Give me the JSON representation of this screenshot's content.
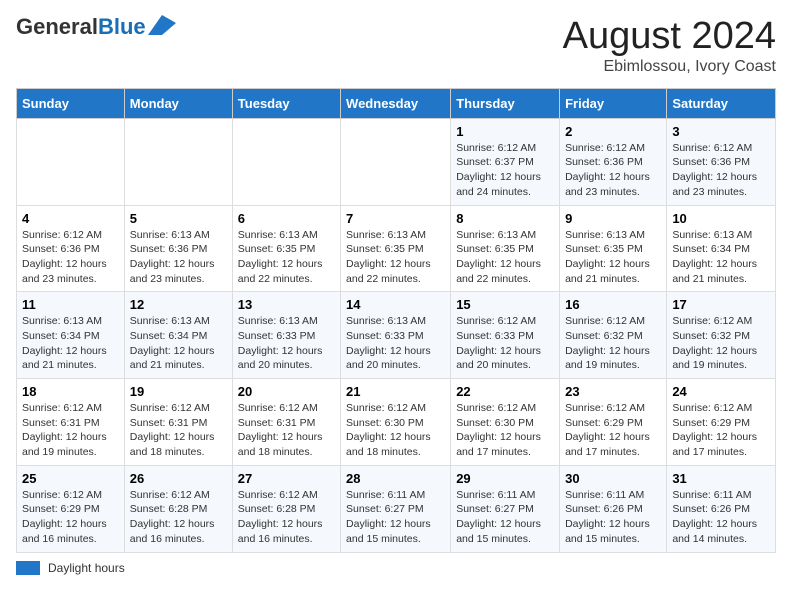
{
  "header": {
    "logo_general": "General",
    "logo_blue": "Blue",
    "title": "August 2024",
    "subtitle": "Ebimlossou, Ivory Coast"
  },
  "weekdays": [
    "Sunday",
    "Monday",
    "Tuesday",
    "Wednesday",
    "Thursday",
    "Friday",
    "Saturday"
  ],
  "weeks": [
    [
      {
        "day": "",
        "detail": ""
      },
      {
        "day": "",
        "detail": ""
      },
      {
        "day": "",
        "detail": ""
      },
      {
        "day": "",
        "detail": ""
      },
      {
        "day": "1",
        "detail": "Sunrise: 6:12 AM\nSunset: 6:37 PM\nDaylight: 12 hours and 24 minutes."
      },
      {
        "day": "2",
        "detail": "Sunrise: 6:12 AM\nSunset: 6:36 PM\nDaylight: 12 hours and 23 minutes."
      },
      {
        "day": "3",
        "detail": "Sunrise: 6:12 AM\nSunset: 6:36 PM\nDaylight: 12 hours and 23 minutes."
      }
    ],
    [
      {
        "day": "4",
        "detail": "Sunrise: 6:12 AM\nSunset: 6:36 PM\nDaylight: 12 hours and 23 minutes."
      },
      {
        "day": "5",
        "detail": "Sunrise: 6:13 AM\nSunset: 6:36 PM\nDaylight: 12 hours and 23 minutes."
      },
      {
        "day": "6",
        "detail": "Sunrise: 6:13 AM\nSunset: 6:35 PM\nDaylight: 12 hours and 22 minutes."
      },
      {
        "day": "7",
        "detail": "Sunrise: 6:13 AM\nSunset: 6:35 PM\nDaylight: 12 hours and 22 minutes."
      },
      {
        "day": "8",
        "detail": "Sunrise: 6:13 AM\nSunset: 6:35 PM\nDaylight: 12 hours and 22 minutes."
      },
      {
        "day": "9",
        "detail": "Sunrise: 6:13 AM\nSunset: 6:35 PM\nDaylight: 12 hours and 21 minutes."
      },
      {
        "day": "10",
        "detail": "Sunrise: 6:13 AM\nSunset: 6:34 PM\nDaylight: 12 hours and 21 minutes."
      }
    ],
    [
      {
        "day": "11",
        "detail": "Sunrise: 6:13 AM\nSunset: 6:34 PM\nDaylight: 12 hours and 21 minutes."
      },
      {
        "day": "12",
        "detail": "Sunrise: 6:13 AM\nSunset: 6:34 PM\nDaylight: 12 hours and 21 minutes."
      },
      {
        "day": "13",
        "detail": "Sunrise: 6:13 AM\nSunset: 6:33 PM\nDaylight: 12 hours and 20 minutes."
      },
      {
        "day": "14",
        "detail": "Sunrise: 6:13 AM\nSunset: 6:33 PM\nDaylight: 12 hours and 20 minutes."
      },
      {
        "day": "15",
        "detail": "Sunrise: 6:12 AM\nSunset: 6:33 PM\nDaylight: 12 hours and 20 minutes."
      },
      {
        "day": "16",
        "detail": "Sunrise: 6:12 AM\nSunset: 6:32 PM\nDaylight: 12 hours and 19 minutes."
      },
      {
        "day": "17",
        "detail": "Sunrise: 6:12 AM\nSunset: 6:32 PM\nDaylight: 12 hours and 19 minutes."
      }
    ],
    [
      {
        "day": "18",
        "detail": "Sunrise: 6:12 AM\nSunset: 6:31 PM\nDaylight: 12 hours and 19 minutes."
      },
      {
        "day": "19",
        "detail": "Sunrise: 6:12 AM\nSunset: 6:31 PM\nDaylight: 12 hours and 18 minutes."
      },
      {
        "day": "20",
        "detail": "Sunrise: 6:12 AM\nSunset: 6:31 PM\nDaylight: 12 hours and 18 minutes."
      },
      {
        "day": "21",
        "detail": "Sunrise: 6:12 AM\nSunset: 6:30 PM\nDaylight: 12 hours and 18 minutes."
      },
      {
        "day": "22",
        "detail": "Sunrise: 6:12 AM\nSunset: 6:30 PM\nDaylight: 12 hours and 17 minutes."
      },
      {
        "day": "23",
        "detail": "Sunrise: 6:12 AM\nSunset: 6:29 PM\nDaylight: 12 hours and 17 minutes."
      },
      {
        "day": "24",
        "detail": "Sunrise: 6:12 AM\nSunset: 6:29 PM\nDaylight: 12 hours and 17 minutes."
      }
    ],
    [
      {
        "day": "25",
        "detail": "Sunrise: 6:12 AM\nSunset: 6:29 PM\nDaylight: 12 hours and 16 minutes."
      },
      {
        "day": "26",
        "detail": "Sunrise: 6:12 AM\nSunset: 6:28 PM\nDaylight: 12 hours and 16 minutes."
      },
      {
        "day": "27",
        "detail": "Sunrise: 6:12 AM\nSunset: 6:28 PM\nDaylight: 12 hours and 16 minutes."
      },
      {
        "day": "28",
        "detail": "Sunrise: 6:11 AM\nSunset: 6:27 PM\nDaylight: 12 hours and 15 minutes."
      },
      {
        "day": "29",
        "detail": "Sunrise: 6:11 AM\nSunset: 6:27 PM\nDaylight: 12 hours and 15 minutes."
      },
      {
        "day": "30",
        "detail": "Sunrise: 6:11 AM\nSunset: 6:26 PM\nDaylight: 12 hours and 15 minutes."
      },
      {
        "day": "31",
        "detail": "Sunrise: 6:11 AM\nSunset: 6:26 PM\nDaylight: 12 hours and 14 minutes."
      }
    ]
  ],
  "legend": {
    "daylight_label": "Daylight hours"
  }
}
